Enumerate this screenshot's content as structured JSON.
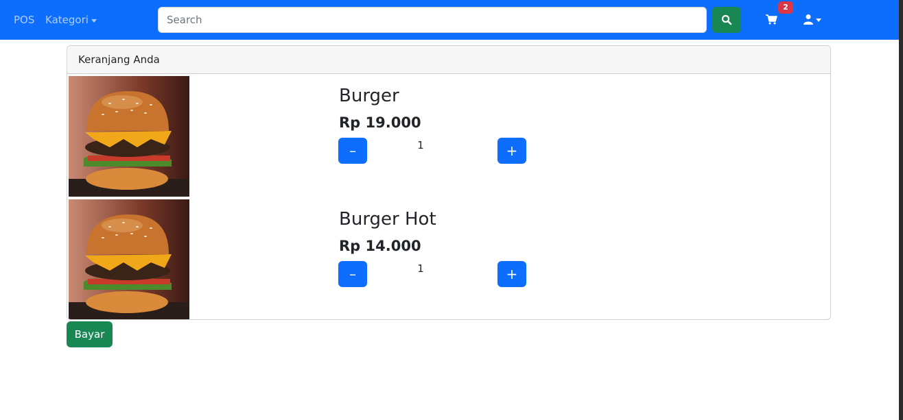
{
  "navbar": {
    "brand": "POS",
    "category_label": "Kategori",
    "search_placeholder": "Search",
    "search_value": "",
    "cart_badge": "2"
  },
  "cart": {
    "header": "Keranjang Anda",
    "items": [
      {
        "name": "Burger",
        "price": "Rp 19.000",
        "quantity": "1",
        "minus_label": "–",
        "plus_label": "+"
      },
      {
        "name": "Burger Hot",
        "price": "Rp 14.000",
        "quantity": "1",
        "minus_label": "–",
        "plus_label": "+"
      }
    ],
    "pay_label": "Bayar"
  },
  "colors": {
    "primary": "#0d6efd",
    "success": "#198754",
    "danger": "#dc3545"
  },
  "icons": [
    "search-icon",
    "cart-icon",
    "user-icon",
    "chevron-down-icon"
  ]
}
